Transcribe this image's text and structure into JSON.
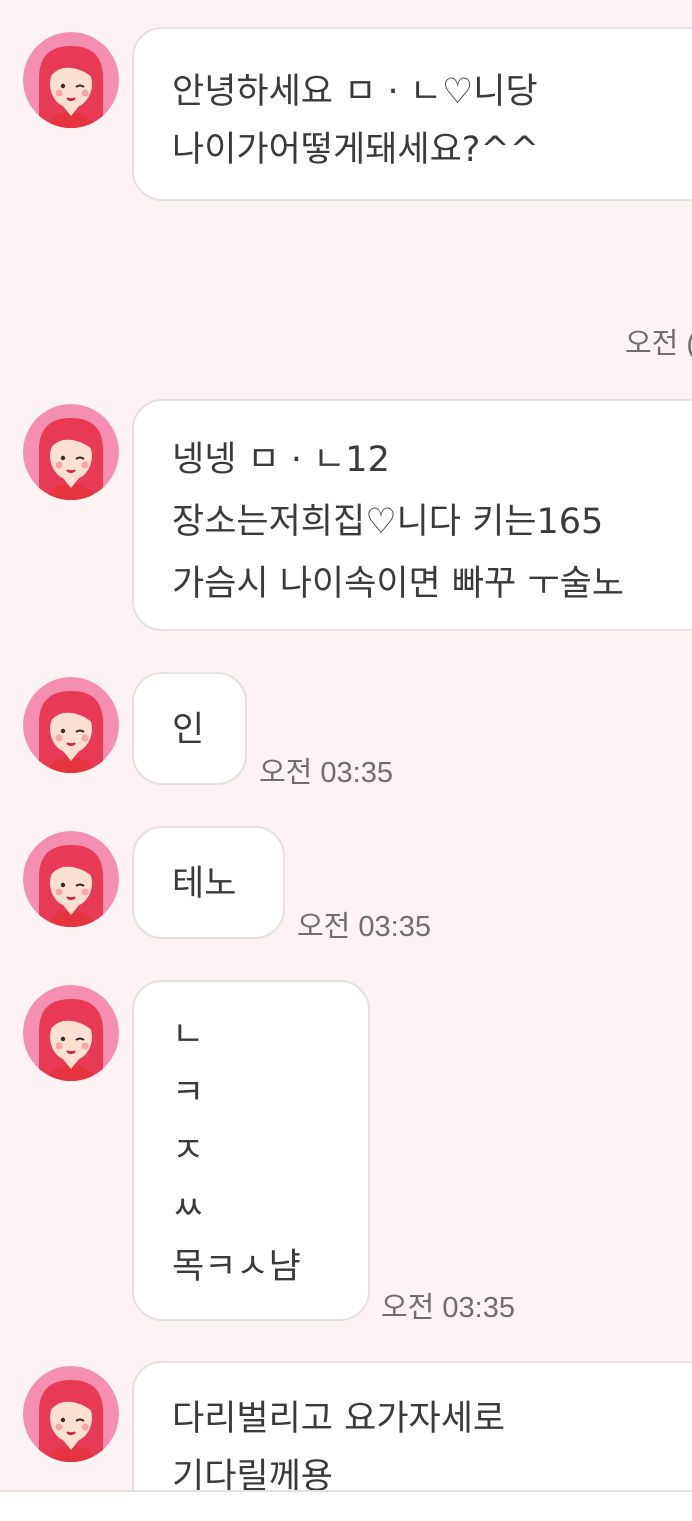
{
  "avatar_icon": "girl-red-hair-avatar-icon",
  "colors": {
    "background": "#fdf3f4",
    "bubble": "#ffffff",
    "bubble_border": "#e6e0e1",
    "avatar_bg": "#f48fb1",
    "hair": "#e93a55",
    "text": "#3a3a3a",
    "timestamp": "#6e6e6e"
  },
  "messages": [
    {
      "lines": [
        "안녕하세요 ㅁ · ㄴ♡니당",
        "나이가어떻게돼세요?^^"
      ],
      "time": ""
    },
    {
      "lines": [],
      "time": "오전 ("
    },
    {
      "lines": [
        "넹넹 ㅁ · ㄴ12",
        "장소는저희집♡니다 키는165",
        "가슴시 나이속이면 빠꾸 ㅜ술노"
      ],
      "time": ""
    },
    {
      "lines": [
        "인"
      ],
      "time": "오전 03:35"
    },
    {
      "lines": [
        "테노"
      ],
      "time": "오전 03:35"
    },
    {
      "lines": [
        "ㄴ",
        "ㅋ",
        "ㅈ",
        "ㅆ",
        "목ㅋㅅ냠"
      ],
      "time": "오전 03:35"
    },
    {
      "lines": [
        "다리벌리고 요가자세로",
        "기다릴께용"
      ],
      "time": ""
    }
  ]
}
